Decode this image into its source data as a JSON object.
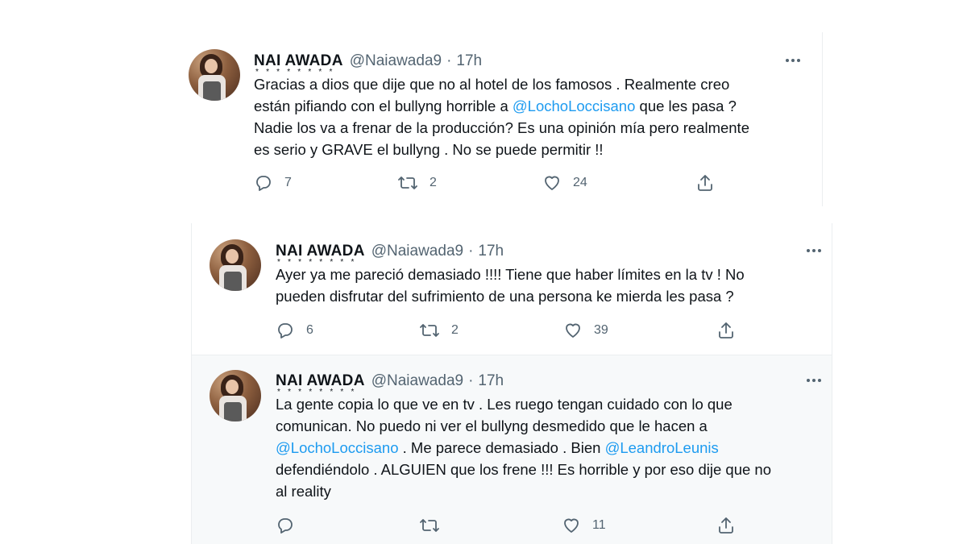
{
  "tweets": [
    {
      "name": "NAI AWADA",
      "name_stars": "* * * * * * * *",
      "handle": "@Naiawada9",
      "separator": "·",
      "time": "17h",
      "text_lines": [
        [
          "Gracias a dios que dije que no al hotel de los famosos . Realmente creo"
        ],
        [
          "están pifiando con el bullyng horrible a ",
          "@LochoLoccisano",
          " que les pasa ?"
        ],
        [
          "Nadie los va a frenar de la producción? Es una opinión mía pero realmente"
        ],
        [
          "es serio y GRAVE el bullyng . No se puede permitir !!"
        ]
      ],
      "replies": "7",
      "retweets": "2",
      "likes": "24"
    },
    {
      "name": "NAI AWADA",
      "name_stars": "* * * * * * * *",
      "handle": "@Naiawada9",
      "separator": "·",
      "time": "17h",
      "text_lines": [
        [
          "Ayer ya me pareció demasiado !!!! Tiene que haber límites en la tv ! No"
        ],
        [
          "pueden disfrutar del sufrimiento de una persona ke mierda les pasa ?"
        ]
      ],
      "replies": "6",
      "retweets": "2",
      "likes": "39"
    },
    {
      "name": "NAI AWADA",
      "name_stars": "* * * * * * * *",
      "handle": "@Naiawada9",
      "separator": "·",
      "time": "17h",
      "text_lines": [
        [
          "La gente copia lo que ve en tv . Les ruego tengan cuidado con lo que"
        ],
        [
          "comunican. No puedo ni ver el bullyng desmedido que le hacen a"
        ],
        [
          "",
          "@LochoLoccisano",
          " . Me parece demasiado . Bien ",
          "@LeandroLeunis"
        ],
        [
          "defendiéndolo . ALGUIEN que los frene !!! Es horrible y por eso dije que no"
        ],
        [
          "al reality"
        ]
      ],
      "replies": "",
      "retweets": "",
      "likes": "11"
    }
  ],
  "icons": {
    "avatar": "profile-photo",
    "more": "more-horizontal-icon",
    "reply": "reply-icon",
    "retweet": "retweet-icon",
    "like": "heart-icon",
    "share": "share-icon"
  },
  "colors": {
    "text": "#0f1419",
    "secondary": "#536471",
    "mention": "#1d9bf0",
    "border": "#ebeef0",
    "selected_bg": "#f7f9fa"
  }
}
